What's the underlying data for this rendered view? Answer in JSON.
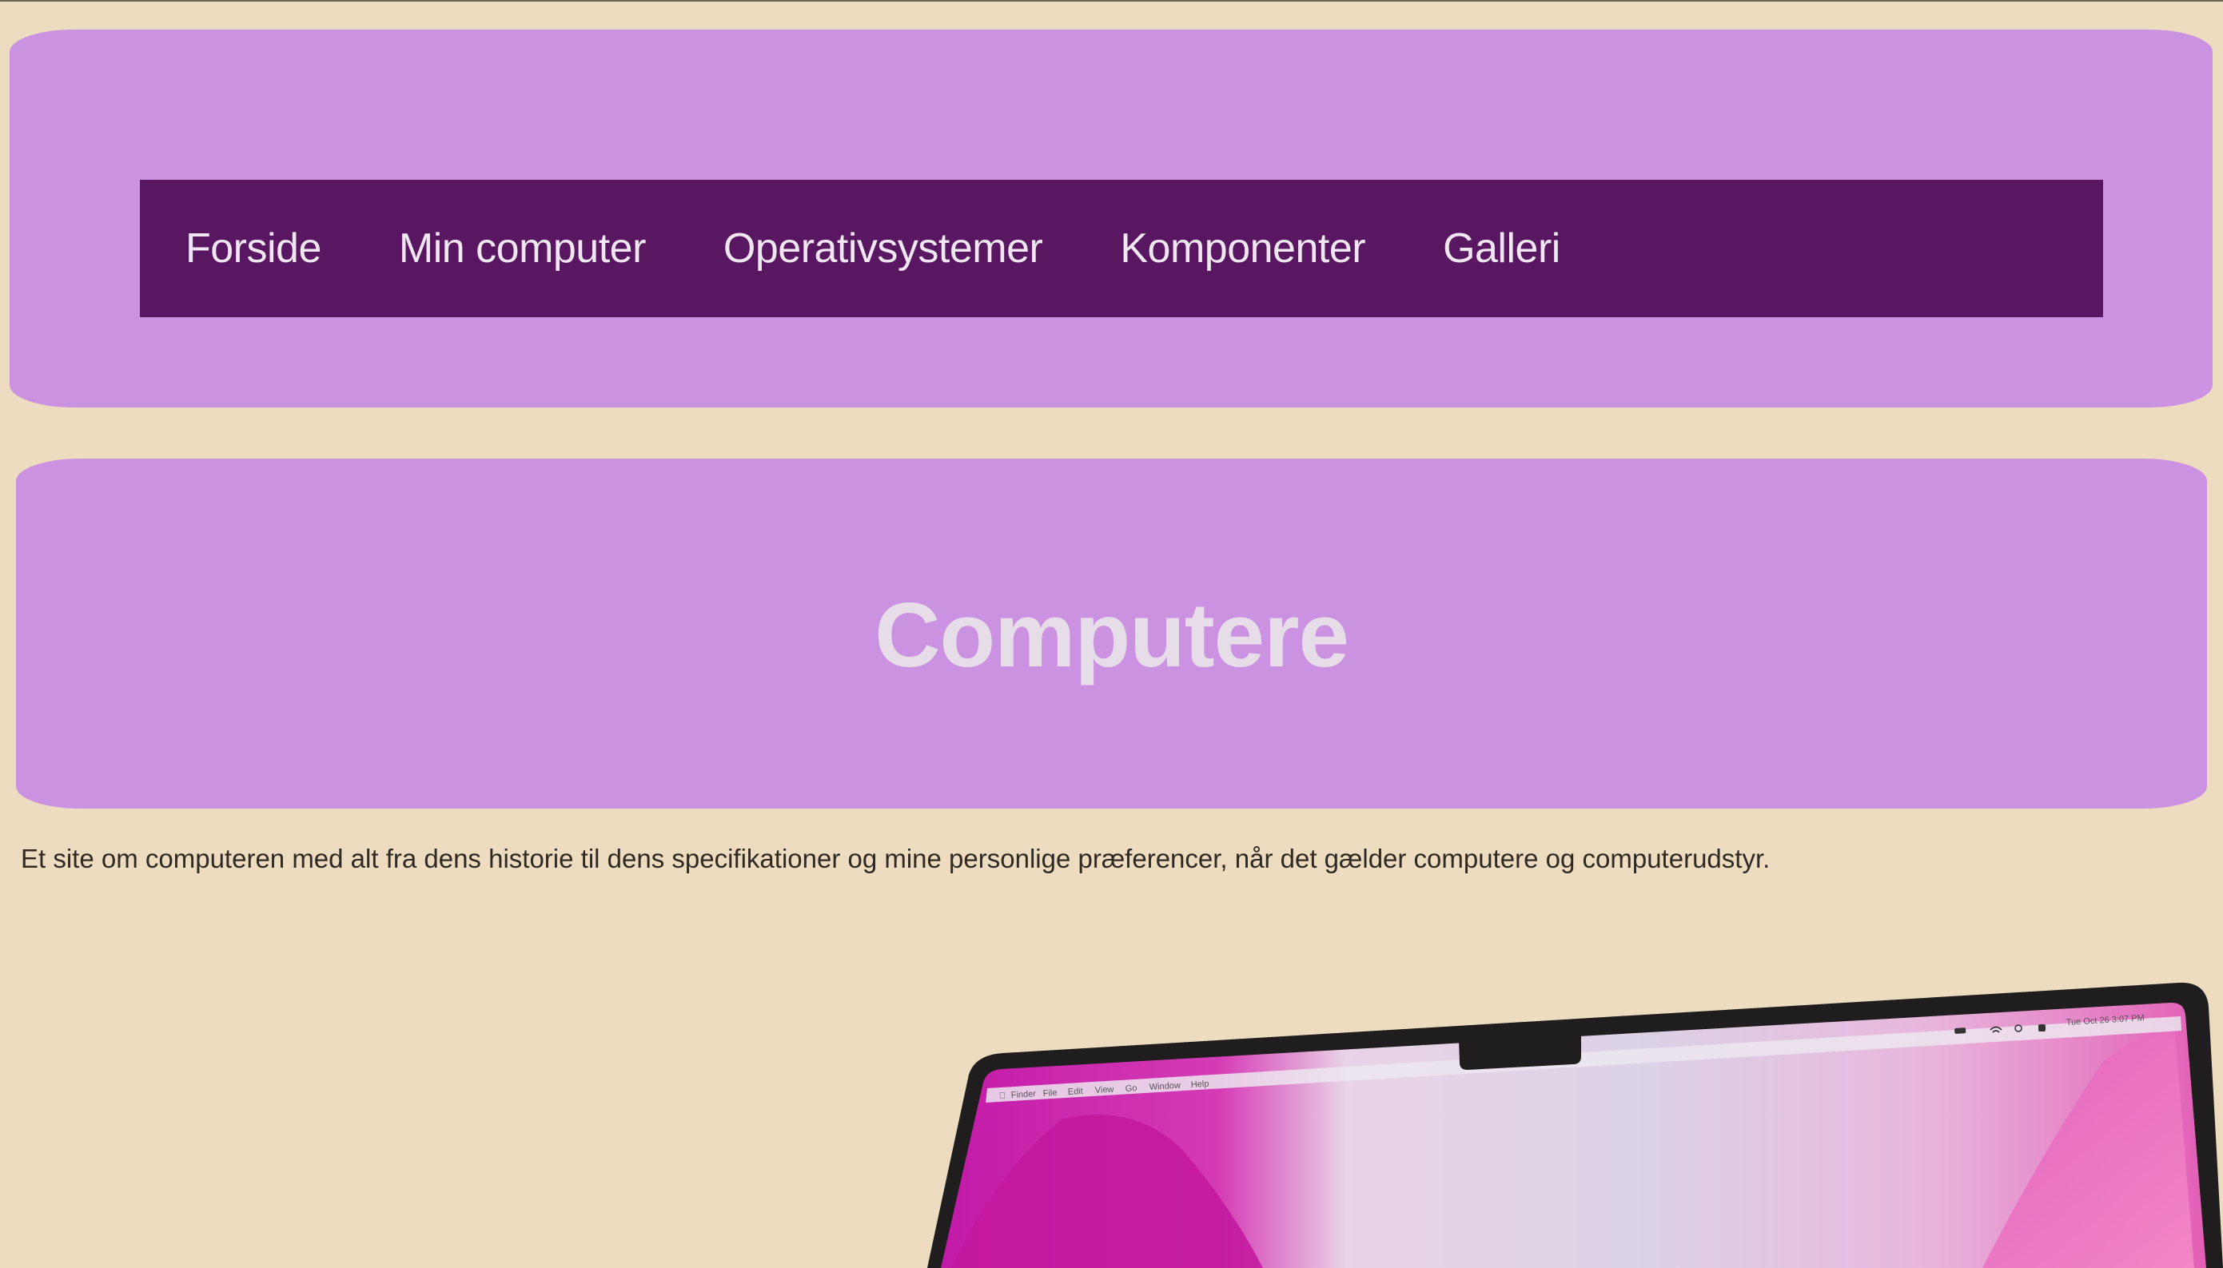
{
  "nav": {
    "items": [
      {
        "label": "Forside"
      },
      {
        "label": "Min computer"
      },
      {
        "label": "Operativsystemer"
      },
      {
        "label": "Komponenter"
      },
      {
        "label": "Galleri"
      }
    ]
  },
  "hero": {
    "title": "Computere"
  },
  "intro": {
    "text": "Et site om computeren med alt fra dens historie til dens specifikationer og mine personlige præferencer, når det gælder computere og computerudstyr."
  },
  "laptop_screen": {
    "menubar_items": [
      "Finder",
      "File",
      "Edit",
      "View",
      "Go",
      "Window",
      "Help"
    ],
    "clock": "Tue Oct 26  3:07 PM"
  },
  "colors": {
    "page_bg": "#eddcbf",
    "band": "#cc92e2",
    "nav_bg": "#581760",
    "nav_text": "#f0e7f2",
    "title_text": "#e6dde8"
  }
}
